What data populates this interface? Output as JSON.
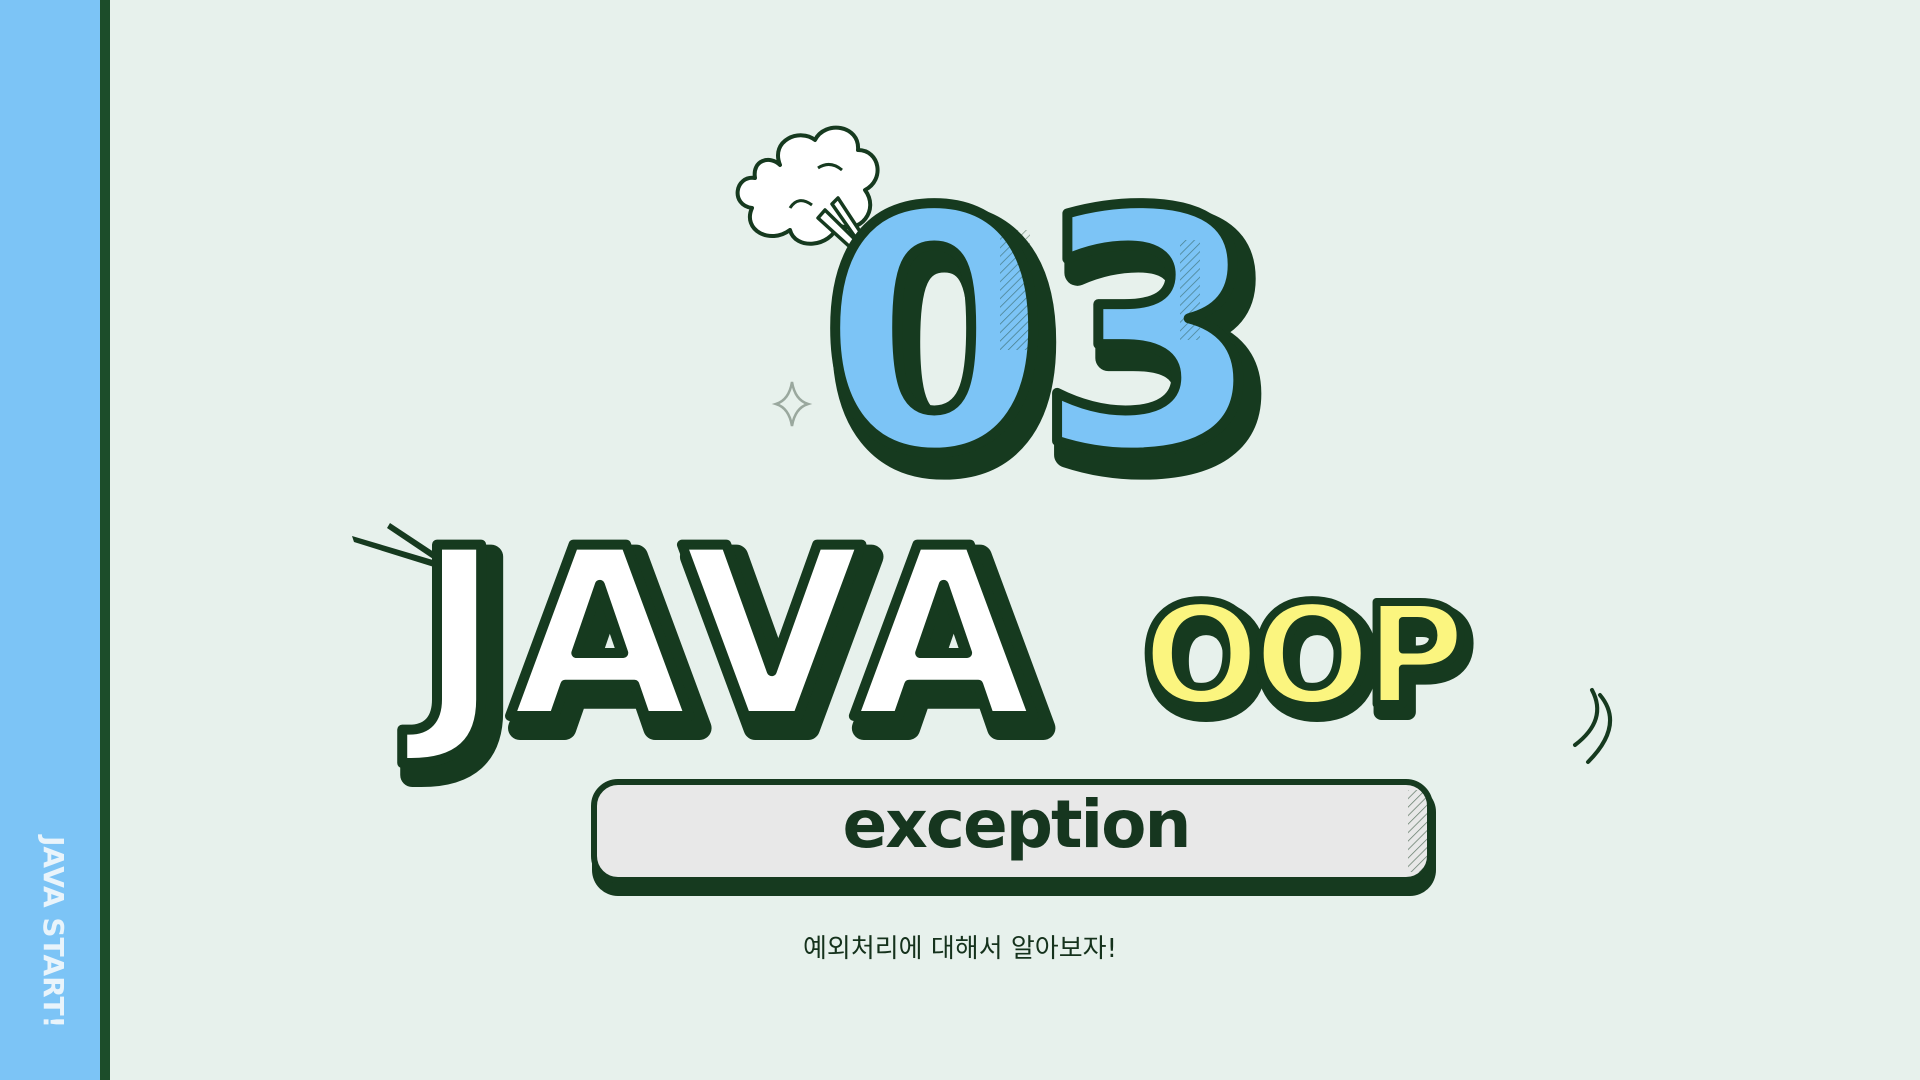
{
  "sidebar": {
    "label": "JAVA START!"
  },
  "title": {
    "number": "03",
    "main": "JAVA",
    "tag": "OOP"
  },
  "pill": {
    "label": "exception"
  },
  "subtitle": "예외처리에 대해서 알아보자!",
  "colors": {
    "background": "#e7f1ec",
    "sidebar": "#7cc4f6",
    "dark_green": "#163a1f",
    "number_fill": "#7cc4f6",
    "oop_fill": "#fbf57f",
    "pill_fill": "#e8e8e8"
  },
  "decorations": [
    "cloud-icon",
    "sparkle-icon",
    "speed-lines-icon"
  ]
}
